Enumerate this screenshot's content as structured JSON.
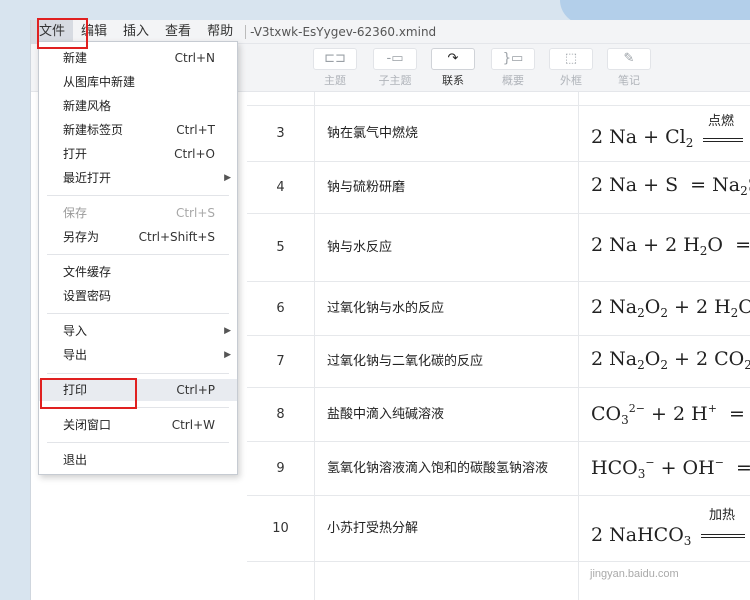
{
  "menubar": {
    "items": [
      "文件",
      "编辑",
      "插入",
      "查看",
      "帮助"
    ],
    "title": "-V3txwk-EsYygev-62360.xmind"
  },
  "toolbar": {
    "buttons": [
      {
        "label": "主题",
        "icon": "topic-icon"
      },
      {
        "label": "子主题",
        "icon": "subtopic-icon"
      },
      {
        "label": "联系",
        "icon": "relationship-icon"
      },
      {
        "label": "概要",
        "icon": "summary-icon"
      },
      {
        "label": "外框",
        "icon": "boundary-icon"
      },
      {
        "label": "笔记",
        "icon": "note-icon"
      }
    ]
  },
  "file_menu": {
    "items": [
      {
        "label": "新建",
        "shortcut": "Ctrl+N"
      },
      {
        "label": "从图库中新建",
        "shortcut": ""
      },
      {
        "label": "新建风格",
        "shortcut": ""
      },
      {
        "label": "新建标签页",
        "shortcut": "Ctrl+T"
      },
      {
        "label": "打开",
        "shortcut": "Ctrl+O"
      },
      {
        "label": "最近打开",
        "shortcut": ""
      },
      {
        "label": "保存",
        "shortcut": "Ctrl+S"
      },
      {
        "label": "另存为",
        "shortcut": "Ctrl+Shift+S"
      },
      {
        "label": "文件缓存",
        "shortcut": ""
      },
      {
        "label": "设置密码",
        "shortcut": ""
      },
      {
        "label": "导入",
        "shortcut": ""
      },
      {
        "label": "导出",
        "shortcut": ""
      },
      {
        "label": "打印",
        "shortcut": "Ctrl+P"
      },
      {
        "label": "关闭窗口",
        "shortcut": "Ctrl+W"
      },
      {
        "label": "退出",
        "shortcut": ""
      }
    ]
  },
  "table": {
    "rows": [
      {
        "num": "3",
        "name": "钠在氯气中燃烧"
      },
      {
        "num": "4",
        "name": "钠与硫粉研磨"
      },
      {
        "num": "5",
        "name": "钠与水反应"
      },
      {
        "num": "6",
        "name": "过氧化钠与水的反应"
      },
      {
        "num": "7",
        "name": "过氧化钠与二氧化碳的反应"
      },
      {
        "num": "8",
        "name": "盐酸中滴入纯碱溶液"
      },
      {
        "num": "9",
        "name": "氢氧化钠溶液滴入饱和的碳酸氢钠溶液"
      },
      {
        "num": "10",
        "name": "小苏打受热分解"
      }
    ],
    "conditions": {
      "ignite": "点燃",
      "heat": "加热"
    }
  },
  "watermark": "jingyan.baidu.com",
  "colors": {
    "highlight_box": "#e02020"
  }
}
